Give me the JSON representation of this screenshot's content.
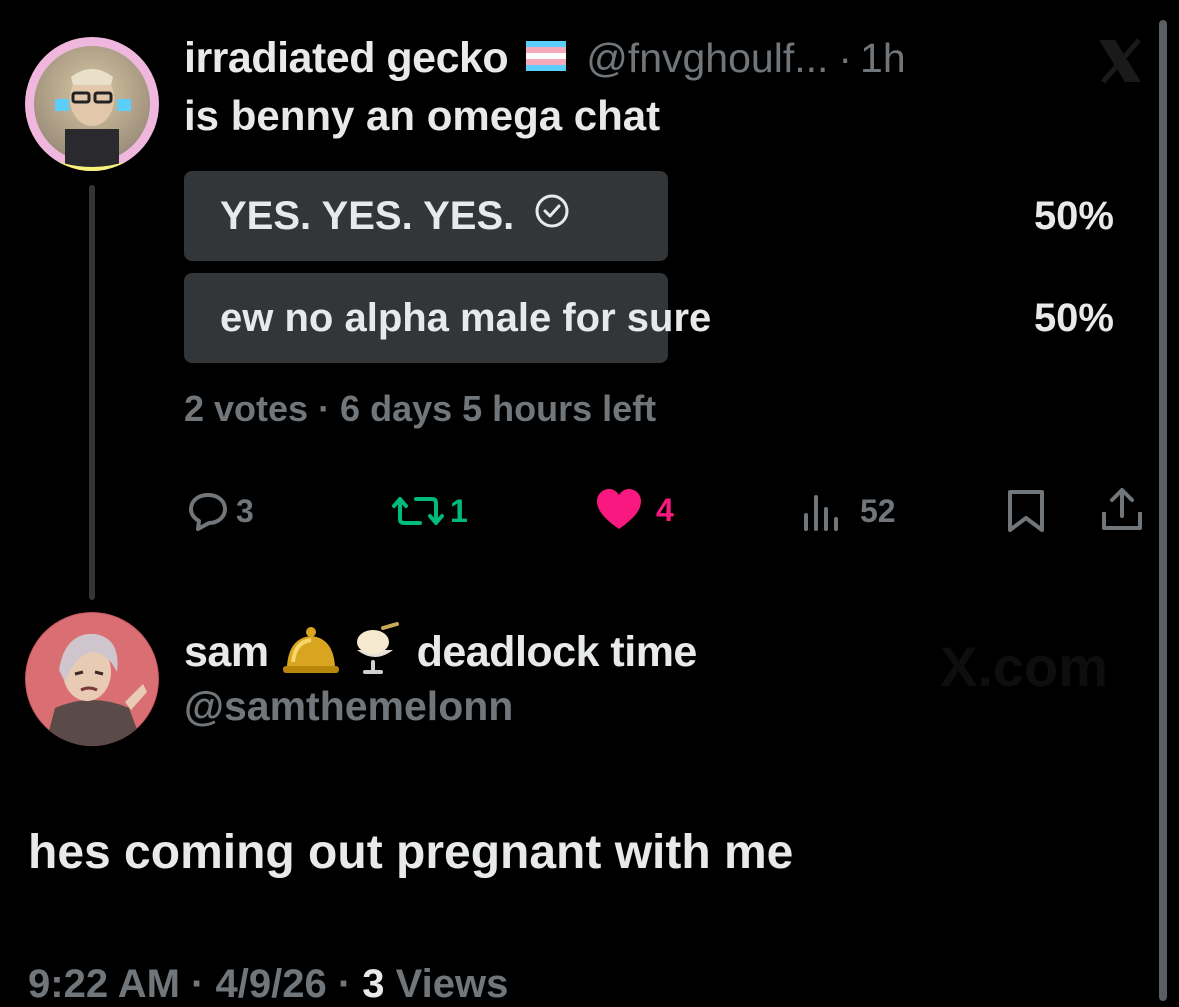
{
  "tweet": {
    "author_name": "irradiated gecko",
    "author_flag_icon": "trans-flag-icon",
    "handle": "@fnvghoulf...",
    "time_sep": "·",
    "time": "1h",
    "text": "is benny an omega chat",
    "poll": {
      "options": [
        {
          "label": "YES. YES. YES.",
          "percent": "50%",
          "fraction": 0.5,
          "selected": true
        },
        {
          "label": "ew no alpha male for sure",
          "percent": "50%",
          "fraction": 0.5,
          "selected": false
        }
      ],
      "meta": "2 votes · 6 days 5 hours left"
    },
    "actions": {
      "replies": "3",
      "reposts": "1",
      "likes": "4",
      "views": "52"
    }
  },
  "reply": {
    "author_name_prefix": "sam",
    "author_emojis": [
      "bell-emoji",
      "shaved-ice-emoji"
    ],
    "author_name_suffix": "deadlock time",
    "handle": "@samthemelonn",
    "text": "hes coming out pregnant with me",
    "footer": {
      "time": "9:22 AM",
      "date": "4/9/26",
      "views_count": "3",
      "views_label": "Views",
      "sep": "·"
    }
  },
  "watermark": "X.com",
  "colors": {
    "background": "#000000",
    "text": "#e7e9ea",
    "muted": "#71767b",
    "poll_bar": "#333639",
    "repost": "#00ba7c",
    "like": "#f91880"
  }
}
